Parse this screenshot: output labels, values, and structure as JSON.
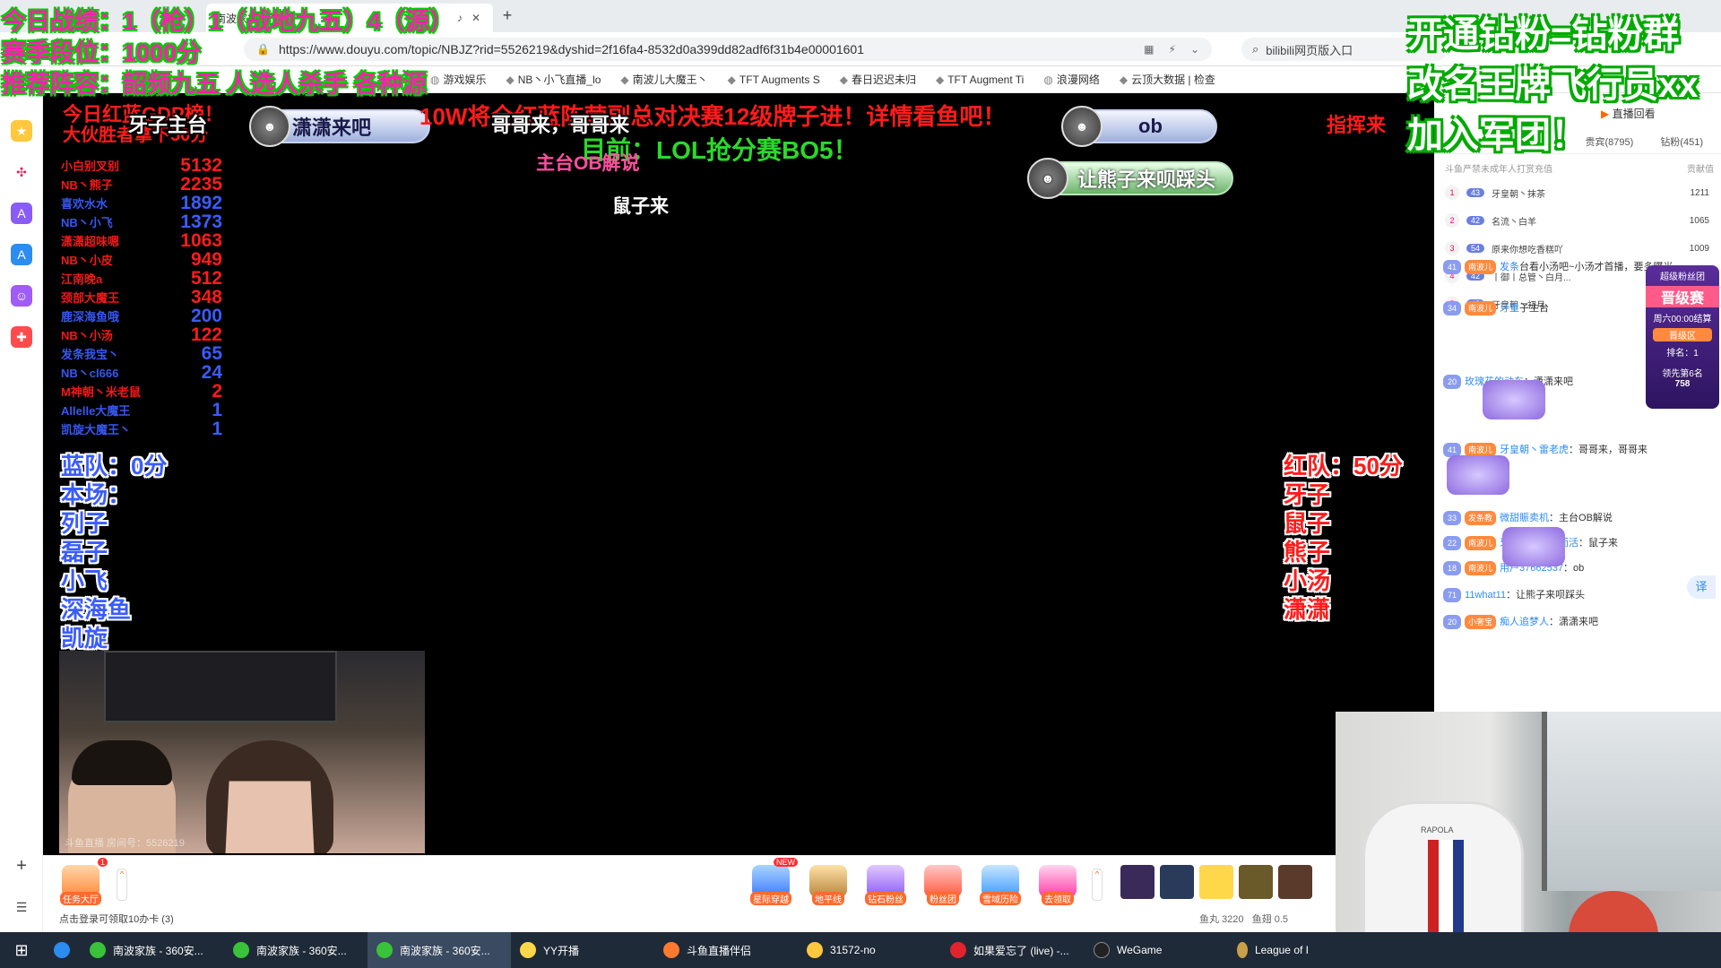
{
  "browser": {
    "tab_title": "南波家族",
    "url": "https://www.douyu.com/topic/NBJZ?rid=5526219&dyshid=2f16fa4-8532d0a399dd82adf6f31b4e00001601",
    "search_placeholder": "bilibili网页版入口",
    "bookmarks": [
      "游戏娱乐",
      "NB丶小飞直播_lo",
      "南波儿大魔王丶",
      "TFT Augments S",
      "春日迟迟未归",
      "TFT Augment Ti",
      "浪漫网络",
      "云顶大数据 | 检查"
    ]
  },
  "overlay": {
    "top_left": [
      "今日战绩：1（枪）1（战地九五）4（源）",
      "赛季段位：1000分",
      "推荐阵容：韶频九五 人选人杀手 各种源"
    ],
    "top_right": [
      "开通钻粉=钻粉群",
      "改名王牌飞行员xx",
      "加入军团！"
    ],
    "rank_title": "今日红蓝GDP榜！",
    "rank_sub": "大伙胜者拿下50分",
    "host_pill": "牙子主台",
    "rank": [
      {
        "name": "小白别叉别",
        "score": "5132",
        "team": "red"
      },
      {
        "name": "NB丶熊子",
        "score": "2235",
        "team": "red"
      },
      {
        "name": "喜欢水水",
        "score": "1892",
        "team": "blue"
      },
      {
        "name": "NB丶小飞",
        "score": "1373",
        "team": "blue"
      },
      {
        "name": "潇潇超味嗯",
        "score": "1063",
        "team": "red"
      },
      {
        "name": "NB丶小皮",
        "score": "949",
        "team": "red"
      },
      {
        "name": "江南晚a",
        "score": "512",
        "team": "red"
      },
      {
        "name": "颈部大魔王",
        "score": "348",
        "team": "red"
      },
      {
        "name": "鹿深海鱼哦",
        "score": "200",
        "team": "blue"
      },
      {
        "name": "NB丶小汤",
        "score": "122",
        "team": "red"
      },
      {
        "name": "发条我宝丶",
        "score": "65",
        "team": "blue"
      },
      {
        "name": "NB丶cl666",
        "score": "24",
        "team": "blue"
      },
      {
        "name": "M神朝丶米老鼠",
        "score": "2",
        "team": "red"
      },
      {
        "name": "Allelle大魔王",
        "score": "1",
        "team": "blue"
      },
      {
        "name": "凯旋大魔王丶",
        "score": "1",
        "team": "blue"
      }
    ],
    "pills": [
      "潇潇来吧",
      "ob",
      "让熊子来呗踩头"
    ],
    "danmaku_center": "哥哥来，哥哥来",
    "red_banner": "10W将全红蓝陈营副总对决赛12级牌子进！详情看鱼吧！",
    "green_banner": "目前：LOL抢分赛BO5！",
    "pink_text": "主台OB解说",
    "white_text": "鼠子来",
    "right_cut": "指挥来",
    "blue_team": {
      "score": "蓝队：0分",
      "label": "本场：",
      "members": [
        "列子",
        "磊子",
        "小飞",
        "深海鱼",
        "凯旋"
      ]
    },
    "red_team": {
      "score": "红队：50分",
      "members": [
        "牙子",
        "鼠子",
        "熊子",
        "小汤",
        "潇潇"
      ]
    },
    "cam_watermark": "斗鱼直播 房间号：5526219"
  },
  "controls": {
    "task_hall": "任务大厅",
    "task_badge": "1",
    "gifts": [
      {
        "label": "星际穿越",
        "new": "NEW"
      },
      {
        "label": "地平线",
        "new": ""
      },
      {
        "label": "钻石粉丝",
        "new": ""
      },
      {
        "label": "粉丝团",
        "new": ""
      },
      {
        "label": "雪域历险",
        "new": ""
      },
      {
        "label": "去领取",
        "new": ""
      }
    ],
    "login_tip": "点击登录可领取10办卡 (3)",
    "fish_ball": "鱼丸 3220",
    "fish_fin": "鱼翅 0.5"
  },
  "chat": {
    "replay": "直播回看",
    "tab_vip": "贵宾(8795)",
    "tab_fans": "钻粉(451)",
    "rank_notice": "斗鱼严禁未成年人打赏充值",
    "rank_col": "贡献值",
    "contributors": [
      {
        "n": "1",
        "lv": "43",
        "name": "牙皇朝丶抹茶",
        "score": "1211"
      },
      {
        "n": "2",
        "lv": "42",
        "name": "名流丶白羊",
        "score": "1065"
      },
      {
        "n": "3",
        "lv": "54",
        "name": "原来你想吃香糕吖",
        "score": "1009"
      },
      {
        "n": "4",
        "lv": "42",
        "name": "丨御丨总管丶白月...",
        "score": ""
      },
      {
        "n": "5",
        "lv": "45",
        "name": "牙皇朝丶初月",
        "score": ""
      }
    ],
    "messages": [
      {
        "lv": "41",
        "badge": "南波儿",
        "nick": "发条",
        "text": "台看小汤吧~小汤才首播，要多曝光~"
      },
      {
        "lv": "34",
        "badge": "南波儿",
        "nick": "牙皇",
        "text": "子主台"
      },
      {
        "lv": "20",
        "badge": "",
        "nick": "玫瑰花的动车",
        "text": "：潇潇来吧"
      },
      {
        "lv": "41",
        "badge": "南波儿",
        "nick": "牙皇朝丶雷老虎",
        "text": "：哥哥来，哥哥来"
      },
      {
        "lv": "33",
        "badge": "发条教",
        "nick": "微甜賑卖机",
        "text": "：主台OB解说"
      },
      {
        "lv": "22",
        "badge": "南波儿",
        "nick": "牙皇朝丶为生而活",
        "text": "：鼠子来"
      },
      {
        "lv": "18",
        "badge": "南波儿",
        "nick": "用户37662537",
        "text": "：ob"
      },
      {
        "lv": "71",
        "badge": "",
        "nick": "11what11",
        "text": "：让熊子来呗踩头"
      },
      {
        "lv": "20",
        "badge": "小奢宝",
        "nick": "痴人追梦人",
        "text": "：潇潇来吧"
      }
    ],
    "translate": "译",
    "super": {
      "title": "超级粉丝团",
      "main": "晋级赛",
      "time": "周六00:00结算",
      "zone": "晋级区",
      "rank": "排名：1",
      "lead": "领先第6名",
      "lead_val": "758"
    }
  },
  "cam_right": {
    "brand": "RAPOLA"
  },
  "taskbar": {
    "items": [
      "南波家族 - 360安...",
      "南波家族 - 360安...",
      "南波家族 - 360安...",
      "YY开播",
      "斗鱼直播伴侣",
      "31572-no",
      "如果爱忘了 (live) -...",
      "WeGame",
      "League of I"
    ]
  },
  "colors": {
    "red": "#ff1b1b",
    "blue": "#3a5cff",
    "green": "#2bd92b",
    "pink": "#ff1fae"
  }
}
